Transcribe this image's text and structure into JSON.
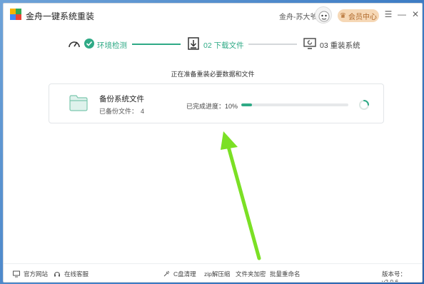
{
  "window": {
    "title": "金舟一键系统重装",
    "user_name": "金舟-苏大爷",
    "vip_label": "会员中心"
  },
  "steps": [
    {
      "label": "环境检测",
      "state": "done"
    },
    {
      "label": "02 下载文件",
      "state": "active"
    },
    {
      "label": "03 重装系统",
      "state": "pending"
    }
  ],
  "status_text": "正在准备重装必要数据和文件",
  "task": {
    "title": "备份系统文件",
    "count_label": "已备份文件：",
    "count_value": "4",
    "progress_label": "已完成进度：",
    "progress_value": "10%",
    "progress_fraction": 0.1
  },
  "footer": {
    "official_site": "官方网站",
    "online_service": "在线客服",
    "tools": [
      "C盘清理",
      "zip解压缩",
      "文件夹加密",
      "批量重命名"
    ],
    "version": "版本号：v2.0.6"
  },
  "colors": {
    "accent": "#2faa86",
    "vip_bg": "#f6d8b6",
    "arrow": "#7be025"
  }
}
